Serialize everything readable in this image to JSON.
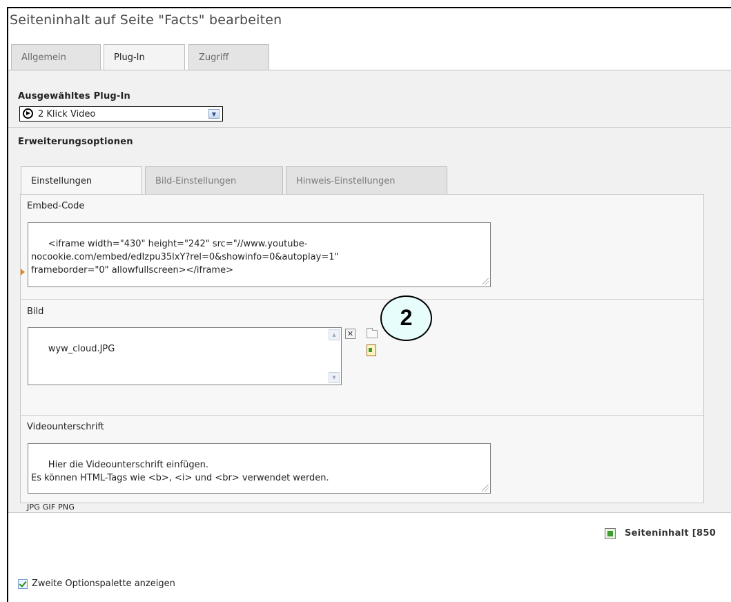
{
  "title": "Seiteninhalt auf Seite \"Facts\" bearbeiten",
  "main_tabs": [
    {
      "label": "Allgemein",
      "active": false
    },
    {
      "label": "Plug-In",
      "active": true
    },
    {
      "label": "Zugriff",
      "active": false
    }
  ],
  "plugin": {
    "heading": "Ausgewähltes Plug-In",
    "selected": "2 Klick Video",
    "icon": "play-circle-icon"
  },
  "options": {
    "heading": "Erweiterungsoptionen",
    "tabs": [
      {
        "label": "Einstellungen",
        "active": true
      },
      {
        "label": "Bild-Einstellungen",
        "active": false
      },
      {
        "label": "Hinweis-Einstellungen",
        "active": false
      }
    ]
  },
  "embed": {
    "label": "Embed-Code",
    "value": "<iframe width=\"430\" height=\"242\" src=\"//www.youtube-\nnocookie.com/embed/edIzpu35lxY?rel=0&showinfo=0&autoplay=1\"\nframeborder=\"0\" allowfullscreen></iframe>"
  },
  "image": {
    "label": "Bild",
    "value": "wyw_cloud.JPG",
    "file_types": "JPG GIF PNG",
    "callout": "2"
  },
  "caption": {
    "label": "Videounterschrift",
    "value": "Hier die Videounterschrift einfügen.\nEs können HTML-Tags wie <b>, <i> und <br> verwendet werden."
  },
  "footer": {
    "save_label": "Seiteninhalt [850",
    "checkbox_label": "Zweite Optionspalette anzeigen",
    "checkbox_checked": true
  }
}
